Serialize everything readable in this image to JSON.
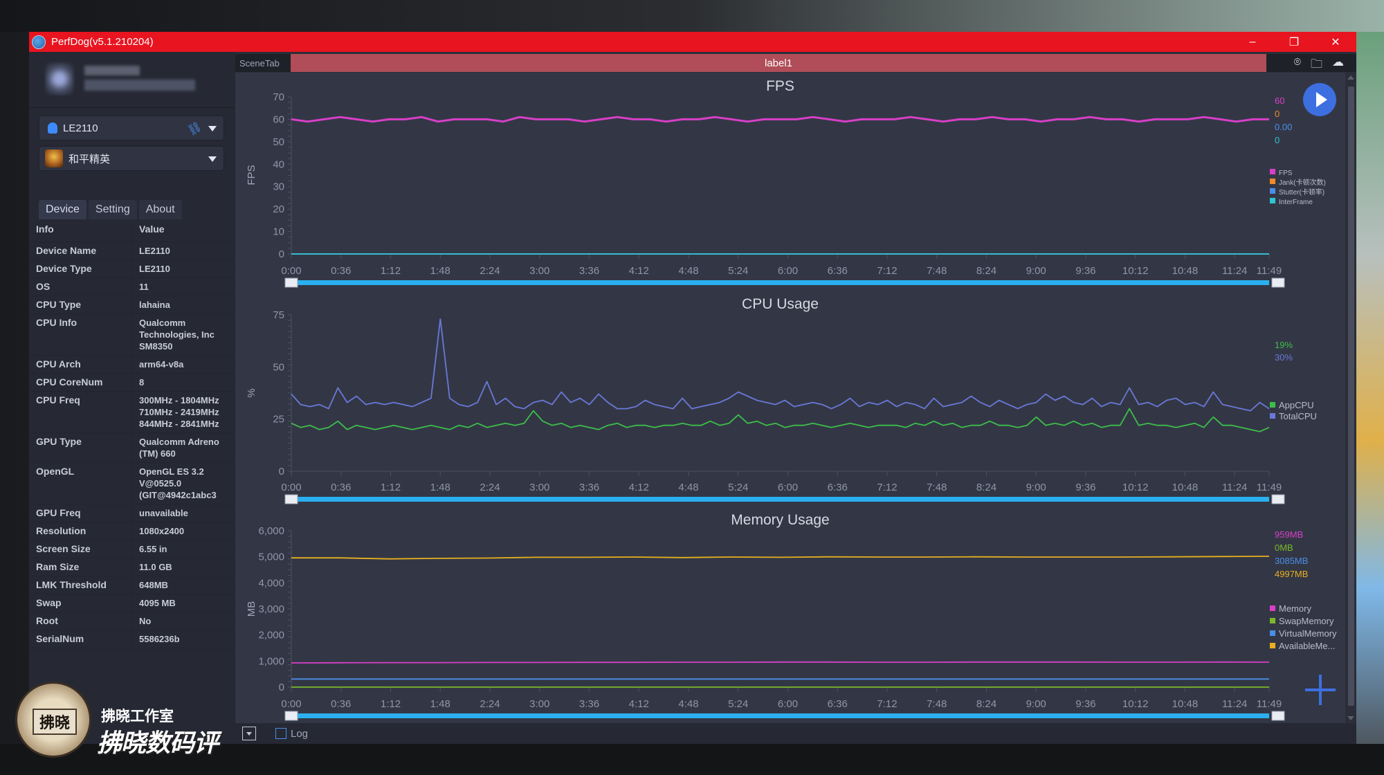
{
  "window": {
    "title": "PerfDog(v5.1.210204)",
    "controls": {
      "minimize": "–",
      "maximize": "❐",
      "close": "✕"
    }
  },
  "colors": {
    "titlebar": "#e8141f",
    "scene_label_bg": "#b04d58",
    "accent": "#3d6fe0",
    "slider": "#2ab0f0"
  },
  "sidebar": {
    "device_select": {
      "value": "LE2110",
      "icon": "android-icon",
      "connection_icon": "usb-link-icon"
    },
    "app_select": {
      "value": "和平精英",
      "icon": "game-app-icon"
    },
    "tabs": [
      {
        "label": "Device",
        "active": true
      },
      {
        "label": "Setting",
        "active": false
      },
      {
        "label": "About",
        "active": false
      }
    ],
    "table_headers": {
      "info": "Info",
      "value": "Value"
    },
    "device_info": [
      {
        "key": "Device Name",
        "value": "LE2110"
      },
      {
        "key": "Device Type",
        "value": "LE2110"
      },
      {
        "key": "OS",
        "value": "11"
      },
      {
        "key": "CPU Type",
        "value": "lahaina"
      },
      {
        "key": "CPU Info",
        "value": "Qualcomm Technologies, Inc SM8350"
      },
      {
        "key": "CPU Arch",
        "value": "arm64-v8a"
      },
      {
        "key": "CPU CoreNum",
        "value": "8"
      },
      {
        "key": "CPU Freq",
        "value": "300MHz - 1804MHz 710MHz - 2419MHz 844MHz - 2841MHz"
      },
      {
        "key": "GPU Type",
        "value": "Qualcomm Adreno (TM) 660"
      },
      {
        "key": "OpenGL",
        "value": "OpenGL ES 3.2 V@0525.0 (GIT@4942c1abc3"
      },
      {
        "key": "GPU Freq",
        "value": "unavailable"
      },
      {
        "key": "Resolution",
        "value": "1080x2400"
      },
      {
        "key": "Screen Size",
        "value": "6.55 in"
      },
      {
        "key": "Ram Size",
        "value": "11.0 GB"
      },
      {
        "key": "LMK Threshold",
        "value": "648MB"
      },
      {
        "key": "Swap",
        "value": "4095 MB"
      },
      {
        "key": "Root",
        "value": "No"
      },
      {
        "key": "SerialNum",
        "value": "5586236b"
      }
    ]
  },
  "scene": {
    "tab_label": "SceneTab",
    "label": "label1",
    "icons": [
      "location-pin-icon",
      "folder-icon",
      "cloud-icon"
    ]
  },
  "bottom_bar": {
    "log_label": "Log",
    "log_checked": false
  },
  "watermark": {
    "small": "拂晓工作室",
    "big": "拂晓数码评",
    "seal": "拂晓"
  },
  "chart_data": [
    {
      "type": "line",
      "title": "FPS",
      "ylabel": "FPS",
      "xlabel": "",
      "ylim": [
        0,
        70
      ],
      "yticks": [
        "0",
        "10",
        "20",
        "30",
        "40",
        "50",
        "60",
        "70"
      ],
      "xticks": [
        "0:00",
        "0:36",
        "1:12",
        "1:48",
        "2:24",
        "3:00",
        "3:36",
        "4:12",
        "4:48",
        "5:24",
        "6:00",
        "6:36",
        "7:12",
        "7:48",
        "8:24",
        "9:00",
        "9:36",
        "10:12",
        "10:48",
        "11:24",
        "11:49"
      ],
      "x_range_seconds": [
        0,
        709
      ],
      "series": [
        {
          "name": "FPS",
          "color": "#d83fc8",
          "current": "60",
          "values": [
            60,
            59,
            60,
            61,
            60,
            59,
            60,
            60,
            61,
            59,
            60,
            60,
            60,
            59,
            61,
            60,
            60,
            60,
            59,
            60,
            61,
            60,
            60,
            59,
            60,
            60,
            61,
            60,
            59,
            60,
            60,
            60,
            61,
            60,
            59,
            60,
            60,
            60,
            61,
            60,
            59,
            60,
            60,
            61,
            60,
            60,
            59,
            60,
            60,
            61,
            60,
            60,
            59,
            60,
            60,
            60,
            61,
            60,
            59,
            60,
            60
          ]
        },
        {
          "name": "Jank(卡顿次数)",
          "color": "#f08a2a",
          "current": "0",
          "values": [
            0,
            0,
            0,
            0,
            0,
            0,
            0,
            0,
            0,
            0,
            0
          ]
        },
        {
          "name": "Stutter(卡顿率)",
          "color": "#4a8ee8",
          "current": "0.00",
          "values": [
            0,
            0,
            0,
            0,
            0,
            0,
            0,
            0,
            0,
            0,
            0
          ]
        },
        {
          "name": "InterFrame",
          "color": "#2ec4d4",
          "current": "0",
          "values": [
            0,
            0,
            0,
            0,
            0,
            0,
            0,
            0,
            0,
            0,
            0
          ]
        }
      ],
      "legend": "right"
    },
    {
      "type": "line",
      "title": "CPU Usage",
      "ylabel": "%",
      "xlabel": "",
      "ylim": [
        0,
        75
      ],
      "yticks": [
        "0",
        "25",
        "50",
        "75"
      ],
      "xticks": [
        "0:00",
        "0:36",
        "1:12",
        "1:48",
        "2:24",
        "3:00",
        "3:36",
        "4:12",
        "4:48",
        "5:24",
        "6:00",
        "6:36",
        "7:12",
        "7:48",
        "8:24",
        "9:00",
        "9:36",
        "10:12",
        "10:48",
        "11:24",
        "11:49"
      ],
      "x_range_seconds": [
        0,
        709
      ],
      "series": [
        {
          "name": "AppCPU",
          "color": "#3cbf4a",
          "current": "19%",
          "values": [
            23,
            21,
            22,
            20,
            21,
            24,
            20,
            22,
            21,
            20,
            21,
            22,
            21,
            20,
            21,
            22,
            21,
            20,
            22,
            21,
            23,
            21,
            22,
            23,
            22,
            23,
            29,
            24,
            22,
            23,
            21,
            22,
            21,
            20,
            22,
            23,
            21,
            22,
            22,
            21,
            22,
            22,
            23,
            22,
            22,
            24,
            22,
            23,
            27,
            23,
            24,
            22,
            23,
            21,
            22,
            22,
            23,
            22,
            21,
            22,
            23,
            22,
            21,
            22,
            22,
            22,
            21,
            23,
            22,
            24,
            22,
            23,
            21,
            22,
            22,
            24,
            22,
            22,
            21,
            22,
            26,
            22,
            23,
            22,
            24,
            22,
            23,
            21,
            22,
            22,
            30,
            22,
            23,
            22,
            22,
            21,
            22,
            23,
            21,
            26,
            22,
            22,
            21,
            20,
            19,
            21
          ]
        },
        {
          "name": "TotalCPU",
          "color": "#6a78d8",
          "current": "30%",
          "values": [
            37,
            32,
            31,
            32,
            30,
            40,
            33,
            36,
            32,
            33,
            32,
            33,
            32,
            31,
            33,
            35,
            73,
            35,
            32,
            31,
            33,
            43,
            32,
            35,
            31,
            30,
            33,
            34,
            32,
            38,
            33,
            35,
            32,
            37,
            33,
            30,
            30,
            31,
            34,
            32,
            31,
            30,
            35,
            30,
            31,
            32,
            33,
            35,
            38,
            36,
            34,
            33,
            32,
            34,
            31,
            32,
            33,
            32,
            30,
            32,
            35,
            31,
            33,
            32,
            34,
            31,
            33,
            32,
            30,
            35,
            31,
            32,
            33,
            36,
            33,
            31,
            34,
            32,
            30,
            32,
            33,
            37,
            34,
            36,
            33,
            32,
            35,
            31,
            33,
            32,
            40,
            32,
            33,
            31,
            34,
            35,
            32,
            33,
            31,
            38,
            32,
            31,
            30,
            29,
            33,
            30
          ]
        }
      ],
      "legend": "right"
    },
    {
      "type": "line",
      "title": "Memory Usage",
      "ylabel": "MB",
      "xlabel": "",
      "ylim": [
        0,
        6000
      ],
      "yticks": [
        "0",
        "1,000",
        "2,000",
        "3,000",
        "4,000",
        "5,000",
        "6,000"
      ],
      "xticks": [
        "0:00",
        "0:36",
        "1:12",
        "1:48",
        "2:24",
        "3:00",
        "3:36",
        "4:12",
        "4:48",
        "5:24",
        "6:00",
        "6:36",
        "7:12",
        "7:48",
        "8:24",
        "9:00",
        "9:36",
        "10:12",
        "10:48",
        "11:24",
        "11:49"
      ],
      "x_range_seconds": [
        0,
        709
      ],
      "series": [
        {
          "name": "Memory",
          "color": "#d83fc8",
          "current": "959MB",
          "values": [
            930,
            935,
            940,
            940,
            945,
            945,
            950,
            950,
            955,
            955,
            960,
            960,
            955,
            955,
            960,
            960,
            960,
            959,
            959,
            960,
            959
          ]
        },
        {
          "name": "SwapMemory",
          "color": "#7ab82a",
          "current": "0MB",
          "values": [
            0,
            0,
            0,
            0,
            0,
            0,
            0,
            0,
            0,
            0,
            0,
            0,
            0,
            0,
            0,
            0,
            0,
            0,
            0,
            0,
            0
          ]
        },
        {
          "name": "VirtualMemory",
          "color": "#4a8ee8",
          "current": "3085MB",
          "values": [
            310,
            310,
            310,
            310,
            310,
            310,
            310,
            310,
            310,
            310,
            310,
            310,
            310,
            310,
            310,
            310,
            310,
            310,
            310,
            310,
            310
          ]
        },
        {
          "name": "AvailableMe...",
          "color": "#e8b020",
          "current": "4997MB",
          "values": [
            4960,
            4960,
            4920,
            4940,
            4950,
            4980,
            4980,
            4990,
            4970,
            4990,
            4980,
            5000,
            4990,
            4990,
            5000,
            4990,
            4990,
            4990,
            5000,
            5010,
            5020
          ]
        }
      ],
      "legend": "right"
    }
  ]
}
